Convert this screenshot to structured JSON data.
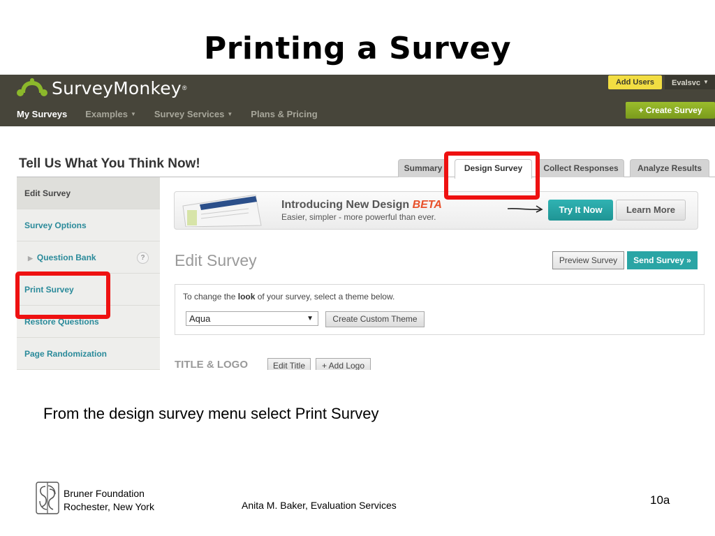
{
  "slide": {
    "title": "Printing a Survey",
    "caption": "From the design survey menu select Print Survey",
    "footer": {
      "org_line1": "Bruner Foundation",
      "org_line2": "Rochester, New York",
      "author": "Anita M. Baker, Evaluation Services",
      "page": "10a"
    }
  },
  "app": {
    "brand": "SurveyMonkey",
    "brand_mark": "®",
    "brand_color": "#8cb82b",
    "header_bg": "#47453a",
    "nav": [
      {
        "label": "My Surveys",
        "active": true,
        "dropdown": false
      },
      {
        "label": "Examples",
        "active": false,
        "dropdown": true
      },
      {
        "label": "Survey Services",
        "active": false,
        "dropdown": true
      },
      {
        "label": "Plans & Pricing",
        "active": false,
        "dropdown": false
      }
    ],
    "add_users_label": "Add Users",
    "account_label": "Evalsvc",
    "create_survey_label": "+ Create Survey",
    "dropdown_caret": "▼"
  },
  "survey": {
    "name": "Tell Us What You Think Now!",
    "tabs": [
      {
        "label": "Summary",
        "active": false
      },
      {
        "label": "Design Survey",
        "active": true
      },
      {
        "label": "Collect Responses",
        "active": false
      },
      {
        "label": "Analyze Results",
        "active": false
      }
    ],
    "sidebar": [
      {
        "label": "Edit Survey",
        "current": true
      },
      {
        "label": "Survey Options",
        "current": false
      },
      {
        "label": "Question Bank",
        "current": false,
        "expandable": true,
        "help": "?"
      },
      {
        "label": "Print Survey",
        "current": false
      },
      {
        "label": "Restore Questions",
        "current": false
      },
      {
        "label": "Page Randomization",
        "current": false
      }
    ],
    "promo": {
      "title": "Introducing New Design",
      "badge": "BETA",
      "subtitle": "Easier, simpler - more powerful than ever.",
      "try_label": "Try It Now",
      "learn_label": "Learn More",
      "accent_color": "#2aa5a5"
    },
    "edit_heading": "Edit Survey",
    "preview_label": "Preview Survey",
    "send_label": "Send Survey »",
    "theme": {
      "text_before": "To change the ",
      "text_bold": "look",
      "text_after": " of your survey, select a theme below.",
      "selected": "Aqua",
      "custom_label": "Create Custom Theme"
    },
    "title_logo": {
      "heading": "TITLE & LOGO",
      "edit_title_label": "Edit Title",
      "add_logo_label": "+ Add Logo"
    }
  },
  "annotations": {
    "highlight_color": "#ee1111",
    "targets": [
      "Design Survey",
      "Print Survey"
    ]
  }
}
